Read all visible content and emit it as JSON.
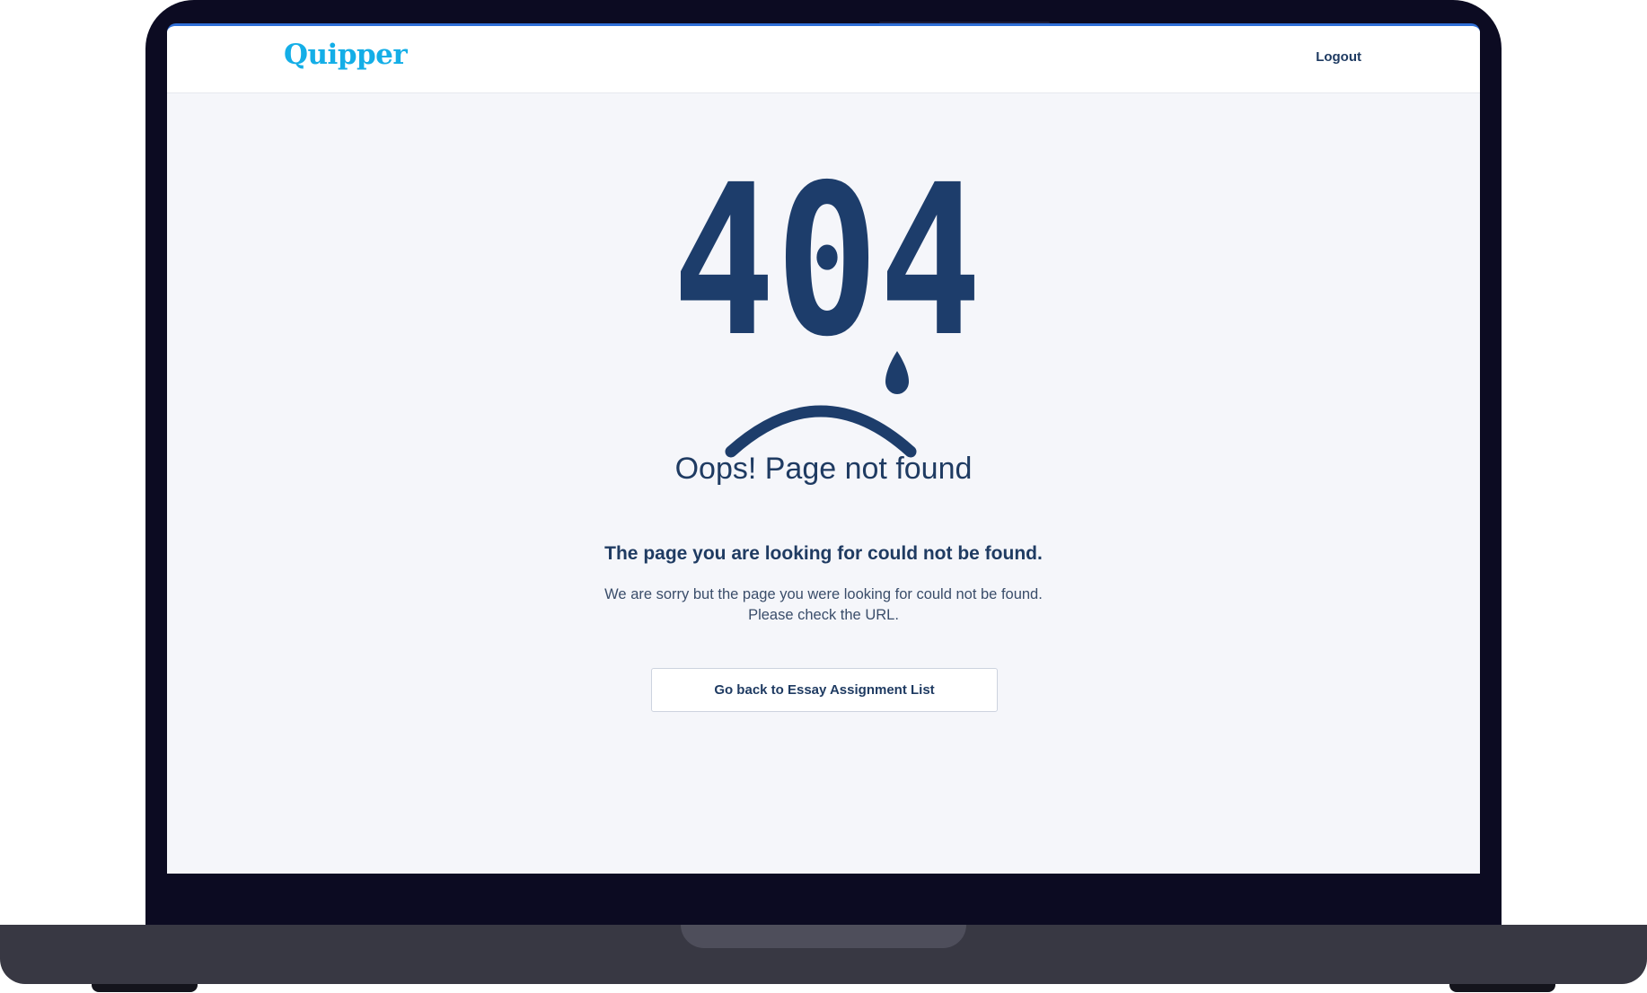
{
  "header": {
    "logo_text": "Quipper",
    "logout_label": "Logout"
  },
  "error": {
    "code": "404",
    "title": "Oops! Page not found",
    "subtitle": "The page you are looking for could not be found.",
    "description_line1": "We are sorry but the page you were looking for could not be found.",
    "description_line2": "Please check the URL.",
    "back_button_label": "Go back to Essay Assignment List"
  },
  "colors": {
    "brand": "#14aee7",
    "primary_text": "#1f3b62",
    "illustration": "#1d3d6b",
    "page_background": "#f5f6fa",
    "device_frame": "#0c0b22"
  },
  "icons": {
    "teardrop": "teardrop-icon",
    "frown": "sad-mouth-icon"
  }
}
